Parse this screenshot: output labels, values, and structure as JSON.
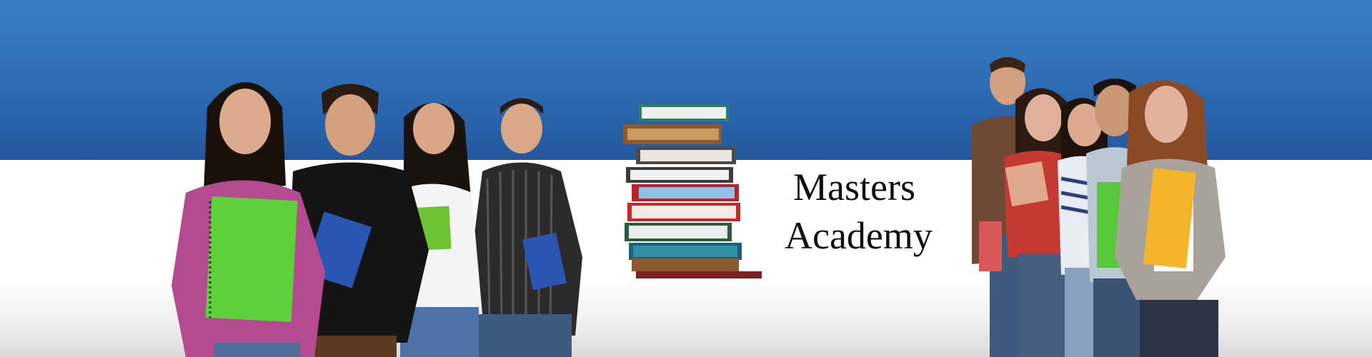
{
  "banner": {
    "brand": {
      "line1": "Masters",
      "line2": "Academy"
    },
    "colors": {
      "top_band": "#2f6fb6",
      "bottom_band": "#ffffff",
      "text": "#111111"
    },
    "images": {
      "left_group": "students-group-left-photo",
      "book_stack": "book-stack-icon",
      "right_group": "students-group-right-photo"
    }
  }
}
